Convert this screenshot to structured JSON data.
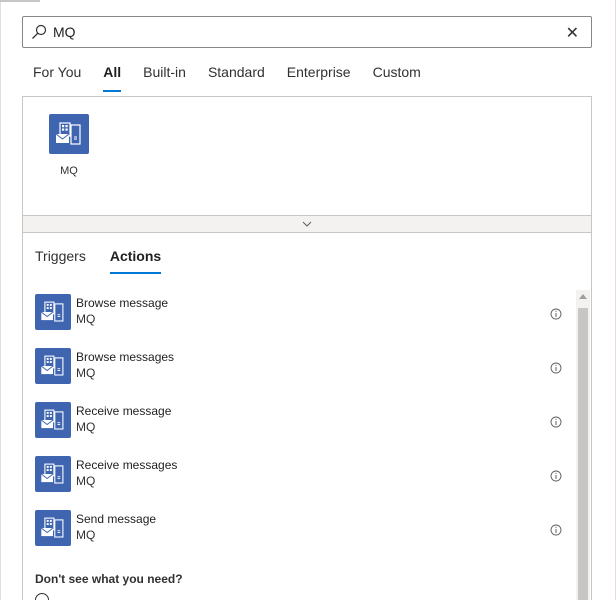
{
  "search": {
    "value": "MQ"
  },
  "category_tabs": [
    {
      "label": "For You"
    },
    {
      "label": "All",
      "active": true
    },
    {
      "label": "Built-in"
    },
    {
      "label": "Standard"
    },
    {
      "label": "Enterprise"
    },
    {
      "label": "Custom"
    }
  ],
  "connectors": [
    {
      "label": "MQ",
      "icon": "mq-connector-icon"
    }
  ],
  "sub_tabs": [
    {
      "label": "Triggers"
    },
    {
      "label": "Actions",
      "active": true
    }
  ],
  "actions": [
    {
      "name": "Browse message",
      "connector": "MQ"
    },
    {
      "name": "Browse messages",
      "connector": "MQ"
    },
    {
      "name": "Receive message",
      "connector": "MQ"
    },
    {
      "name": "Receive messages",
      "connector": "MQ"
    },
    {
      "name": "Send message",
      "connector": "MQ"
    }
  ],
  "help": {
    "dont_see": "Don't see what you need?"
  },
  "colors": {
    "accent": "#0078d4",
    "connector": "#3f65b1"
  }
}
